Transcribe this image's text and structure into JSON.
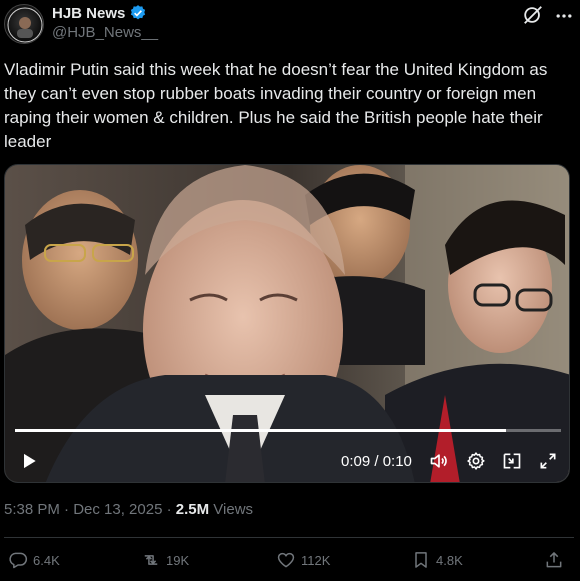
{
  "header": {
    "display_name": "HJB News",
    "handle": "@HJB_News__",
    "avatar_text": "HJB NEWS"
  },
  "tweet": {
    "text": "Vladimir Putin said this week that he doesn’t fear the United Kingdom as they can’t even stop rubber boats invading their country or foreign men raping their women & children. Plus he said the British people hate their leader"
  },
  "video": {
    "time_current": "0:09",
    "time_total": "0:10",
    "time_display": "0:09 / 0:10",
    "progress": 0.9
  },
  "meta": {
    "timestamp": "5:38 PM · Dec 13, 2025 · ",
    "views_count": "2.5M",
    "views_label": " Views"
  },
  "actions": {
    "replies": "6.4K",
    "reposts": "19K",
    "likes": "112K",
    "bookmarks": "4.8K"
  },
  "colors": {
    "background": "#000000",
    "text": "#e7e9ea",
    "muted": "#71767b",
    "verified": "#1d9bf0",
    "divider": "#2f3336"
  },
  "icons": [
    "verified-badge-icon",
    "grok-icon",
    "more-icon",
    "play-icon",
    "volume-icon",
    "settings-icon",
    "pip-icon",
    "fullscreen-icon",
    "reply-icon",
    "repost-icon",
    "like-icon",
    "bookmark-icon",
    "share-icon"
  ]
}
